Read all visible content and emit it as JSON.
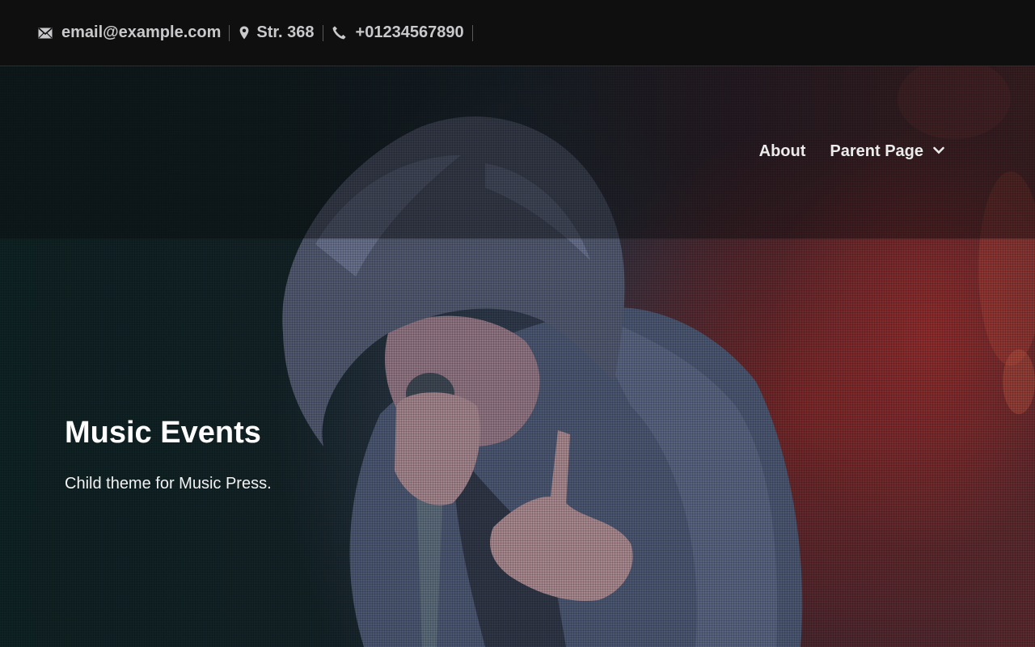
{
  "topbar": {
    "email": "email@example.com",
    "address": "Str. 368",
    "phone": "+01234567890",
    "icons": {
      "email": "envelope-icon",
      "address": "map-pin-icon",
      "phone": "phone-icon"
    }
  },
  "nav": {
    "items": [
      {
        "label": "About"
      },
      {
        "label": "Parent Page",
        "icon": "chevron-down-icon"
      }
    ]
  },
  "hero": {
    "title": "Music Events",
    "tagline": "Child theme for Music Press.",
    "image": "singer-with-microphone-photo"
  },
  "colors": {
    "topbar_bg": "#0f0f10",
    "topbar_text": "#c9c9cb",
    "hero_text": "#ffffff",
    "hero_left": "#0f2224",
    "hero_right": "#5a2a2e"
  }
}
